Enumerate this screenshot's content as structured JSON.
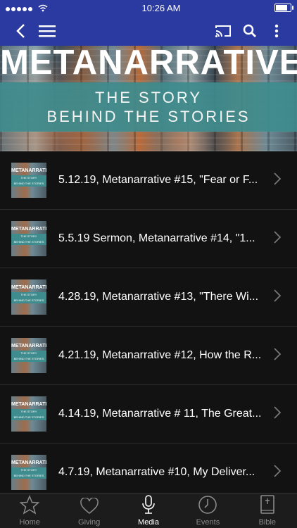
{
  "status": {
    "time": "10:26 AM",
    "battery_level": 0.9
  },
  "banner": {
    "title": "METANARRATIVE",
    "line1": "THE STORY",
    "line2": "BEHIND THE STORIES"
  },
  "items": [
    {
      "title": "5.12.19, Metanarrative #15, \"Fear or F..."
    },
    {
      "title": "5.5.19 Sermon, Metanarrative #14, \"1..."
    },
    {
      "title": "4.28.19, Metanarrative #13, \"There Wi..."
    },
    {
      "title": "4.21.19, Metanarrative #12, How the R..."
    },
    {
      "title": "4.14.19, Metanarrative # 11, The Great..."
    },
    {
      "title": "4.7.19, Metanarrative #10, My Deliver..."
    }
  ],
  "tabs": [
    {
      "label": "Home",
      "icon": "star-icon"
    },
    {
      "label": "Giving",
      "icon": "heart-icon"
    },
    {
      "label": "Media",
      "icon": "microphone-icon"
    },
    {
      "label": "Events",
      "icon": "clock-icon"
    },
    {
      "label": "Bible",
      "icon": "bible-icon"
    }
  ],
  "active_tab": "Media",
  "colors": {
    "header": "#2b3aa0",
    "teal_box": "#3f8c8e",
    "background": "#121212",
    "tabbar": "#1c1c1c"
  }
}
